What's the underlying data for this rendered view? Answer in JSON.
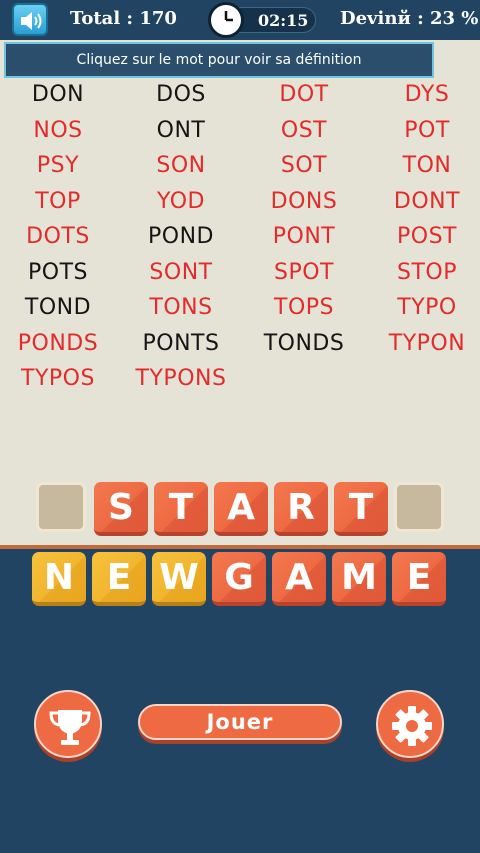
{
  "header": {
    "total": "Total : 170",
    "time": "02:15",
    "guessed": "Devinй : 23 %"
  },
  "hint": "Cliquez sur le mot pour voir sa définition",
  "words": [
    {
      "text": "DON",
      "found": false
    },
    {
      "text": "DOS",
      "found": false
    },
    {
      "text": "DOT",
      "found": true
    },
    {
      "text": "DYS",
      "found": true
    },
    {
      "text": "NOS",
      "found": true
    },
    {
      "text": "ONT",
      "found": false
    },
    {
      "text": "OST",
      "found": true
    },
    {
      "text": "POT",
      "found": true
    },
    {
      "text": "PSY",
      "found": true
    },
    {
      "text": "SON",
      "found": true
    },
    {
      "text": "SOT",
      "found": true
    },
    {
      "text": "TON",
      "found": true
    },
    {
      "text": "TOP",
      "found": true
    },
    {
      "text": "YOD",
      "found": true
    },
    {
      "text": "DONS",
      "found": true
    },
    {
      "text": "DONT",
      "found": true
    },
    {
      "text": "DOTS",
      "found": true
    },
    {
      "text": "POND",
      "found": false
    },
    {
      "text": "PONT",
      "found": true
    },
    {
      "text": "POST",
      "found": true
    },
    {
      "text": "POTS",
      "found": false
    },
    {
      "text": "SONT",
      "found": true
    },
    {
      "text": "SPOT",
      "found": true
    },
    {
      "text": "STOP",
      "found": true
    },
    {
      "text": "TOND",
      "found": false
    },
    {
      "text": "TONS",
      "found": true
    },
    {
      "text": "TOPS",
      "found": true
    },
    {
      "text": "TYPO",
      "found": true
    },
    {
      "text": "PONDS",
      "found": true
    },
    {
      "text": "PONTS",
      "found": false
    },
    {
      "text": "TONDS",
      "found": false
    },
    {
      "text": "TYPON",
      "found": true
    },
    {
      "text": "TYPOS",
      "found": true
    },
    {
      "text": "TYPONS",
      "found": true
    }
  ],
  "start_tiles": [
    "S",
    "T",
    "A",
    "R",
    "T"
  ],
  "newgame_tiles": [
    "N",
    "E",
    "W",
    "G",
    "A",
    "M",
    "E"
  ],
  "play_label": "Jouer",
  "colors": {
    "found": "#e22b2b",
    "not_found": "#151515",
    "tile_orange": "#ee6a43",
    "tile_yellow": "#f2b52f",
    "background": "#214463"
  }
}
